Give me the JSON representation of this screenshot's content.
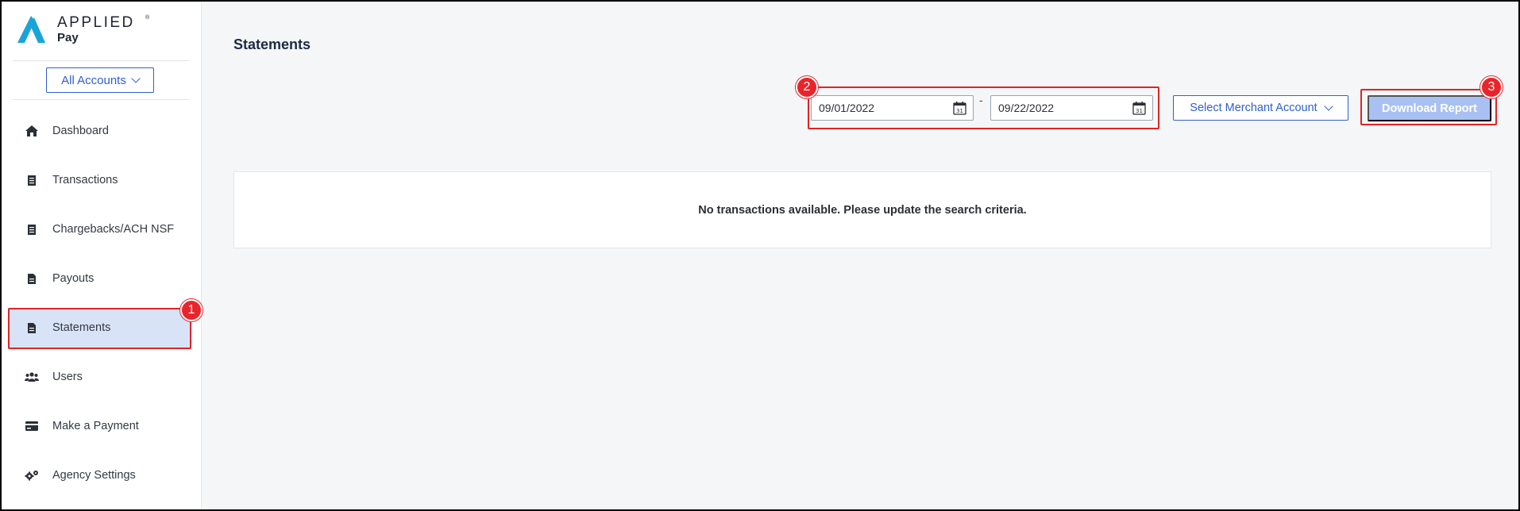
{
  "app": {
    "logo_word": "APPLIED",
    "logo_sub": "Pay",
    "logo_tm": "®",
    "brand_color": "#1aa3d9",
    "accent_color": "#2f5fd0"
  },
  "sidebar": {
    "account_selector": "All Accounts",
    "items": [
      {
        "label": "Dashboard",
        "icon": "home-icon"
      },
      {
        "label": "Transactions",
        "icon": "receipt-icon"
      },
      {
        "label": "Chargebacks/ACH NSF",
        "icon": "receipt-icon"
      },
      {
        "label": "Payouts",
        "icon": "document-icon"
      },
      {
        "label": "Statements",
        "icon": "document-icon",
        "active": true
      },
      {
        "label": "Users",
        "icon": "users-icon"
      },
      {
        "label": "Make a Payment",
        "icon": "credit-card-icon"
      },
      {
        "label": "Agency Settings",
        "icon": "gears-icon"
      }
    ]
  },
  "main": {
    "title": "Statements",
    "date_from": "09/01/2022",
    "date_separator": "-",
    "date_to": "09/22/2022",
    "merchant_select": "Select Merchant Account",
    "download_label": "Download Report",
    "empty_message": "No transactions available. Please update the search criteria."
  },
  "annotations": {
    "badge_1": "1",
    "badge_2": "2",
    "badge_3": "3",
    "highlight_color": "#e02424"
  }
}
